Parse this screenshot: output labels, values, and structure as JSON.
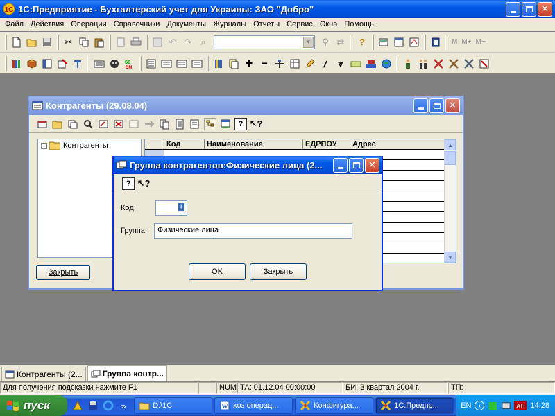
{
  "app": {
    "title": "1С:Предприятие - Бухгалтерский учет для Украины: ЗАО \"Добро\""
  },
  "menu": [
    "Файл",
    "Действия",
    "Операции",
    "Справочники",
    "Документы",
    "Журналы",
    "Отчеты",
    "Сервис",
    "Окна",
    "Помощь"
  ],
  "toolbar": {
    "calc_labels": [
      "M",
      "M+",
      "M−"
    ],
    "colors": {
      "accent": "#0058e6",
      "face": "#ece9d8",
      "desktop": "#808080"
    }
  },
  "kontr_window": {
    "title": "Контрагенты (29.08.04)",
    "tree_root": "Контрагенты",
    "columns": [
      "Код",
      "Наименование",
      "ЕДРПОУ",
      "Адрес"
    ],
    "close_button": "Закрыть"
  },
  "dialog": {
    "title": "Группа контрагентов:Физические лица (2...",
    "code_label": "Код:",
    "code_value": "1",
    "group_label": "Группа:",
    "group_value": "Физические лица",
    "ok_button": "OK",
    "close_button": "Закрыть"
  },
  "mdi_tabs": [
    {
      "label": "Контрагенты (2...",
      "active": false
    },
    {
      "label": "Группа контр...",
      "active": true
    }
  ],
  "statusbar": {
    "hint": "Для получения подсказки нажмите F1",
    "num": "NUM",
    "ta": "ТА: 01.12.04  00:00:00",
    "bi": "БИ: 3 квартал 2004 г.",
    "tp": "ТП:"
  },
  "taskbar": {
    "start_label": "пуск",
    "tasks": [
      {
        "label": "D:\\1C",
        "active": false
      },
      {
        "label": "хоз операц...",
        "active": false
      },
      {
        "label": "Конфигура...",
        "active": false
      },
      {
        "label": "1С:Предпр...",
        "active": true
      }
    ],
    "lang": "EN",
    "clock": "14:28",
    "quicklaunch_more": "»"
  }
}
